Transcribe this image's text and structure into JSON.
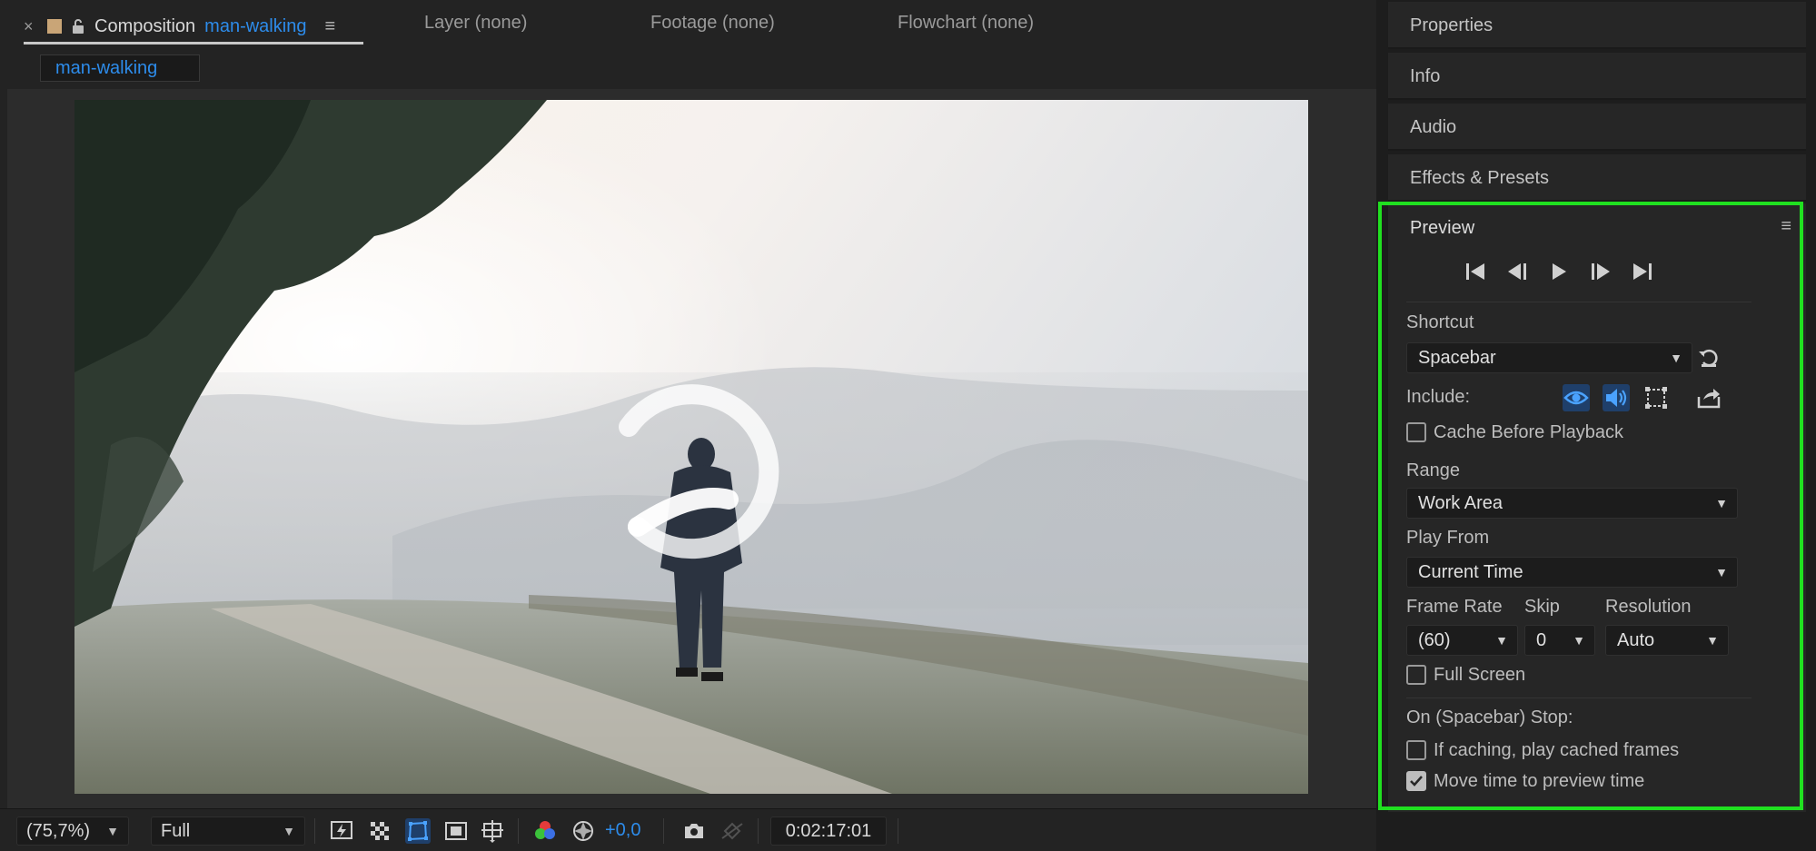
{
  "composition_panel": {
    "tab": {
      "prefix": "Composition",
      "name": "man-walking",
      "close_glyph": "×",
      "menu_glyph": "≡"
    },
    "other_tabs": [
      {
        "prefix": "Layer",
        "value": "(none)"
      },
      {
        "prefix": "Footage",
        "value": "(none)"
      },
      {
        "prefix": "Flowchart",
        "value": "(none)"
      }
    ],
    "breadcrumb": "man-walking",
    "toolbar": {
      "zoom": "(75,7%)",
      "resolution": "Full",
      "exposure": "+0,0",
      "timecode": "0:02:17:01"
    },
    "accent_color": "#2d8ceb"
  },
  "right_panels": {
    "collapsed": [
      "Properties",
      "Info",
      "Audio",
      "Effects & Presets"
    ]
  },
  "preview": {
    "title": "Preview",
    "menu_glyph": "≡",
    "shortcut_label": "Shortcut",
    "shortcut_value": "Spacebar",
    "include_label": "Include:",
    "cache_before_playback": {
      "label": "Cache Before Playback",
      "checked": false
    },
    "range_label": "Range",
    "range_value": "Work Area",
    "play_from_label": "Play From",
    "play_from_value": "Current Time",
    "frame_rate_label": "Frame Rate",
    "frame_rate_value": "(60)",
    "skip_label": "Skip",
    "skip_value": "0",
    "resolution_label": "Resolution",
    "resolution_value": "Auto",
    "full_screen": {
      "label": "Full Screen",
      "checked": false
    },
    "on_stop_label": "On (Spacebar) Stop:",
    "if_caching": {
      "label": "If caching, play cached frames",
      "checked": false
    },
    "move_time": {
      "label": "Move time to preview time",
      "checked": true
    },
    "highlight_color": "#20e020"
  }
}
